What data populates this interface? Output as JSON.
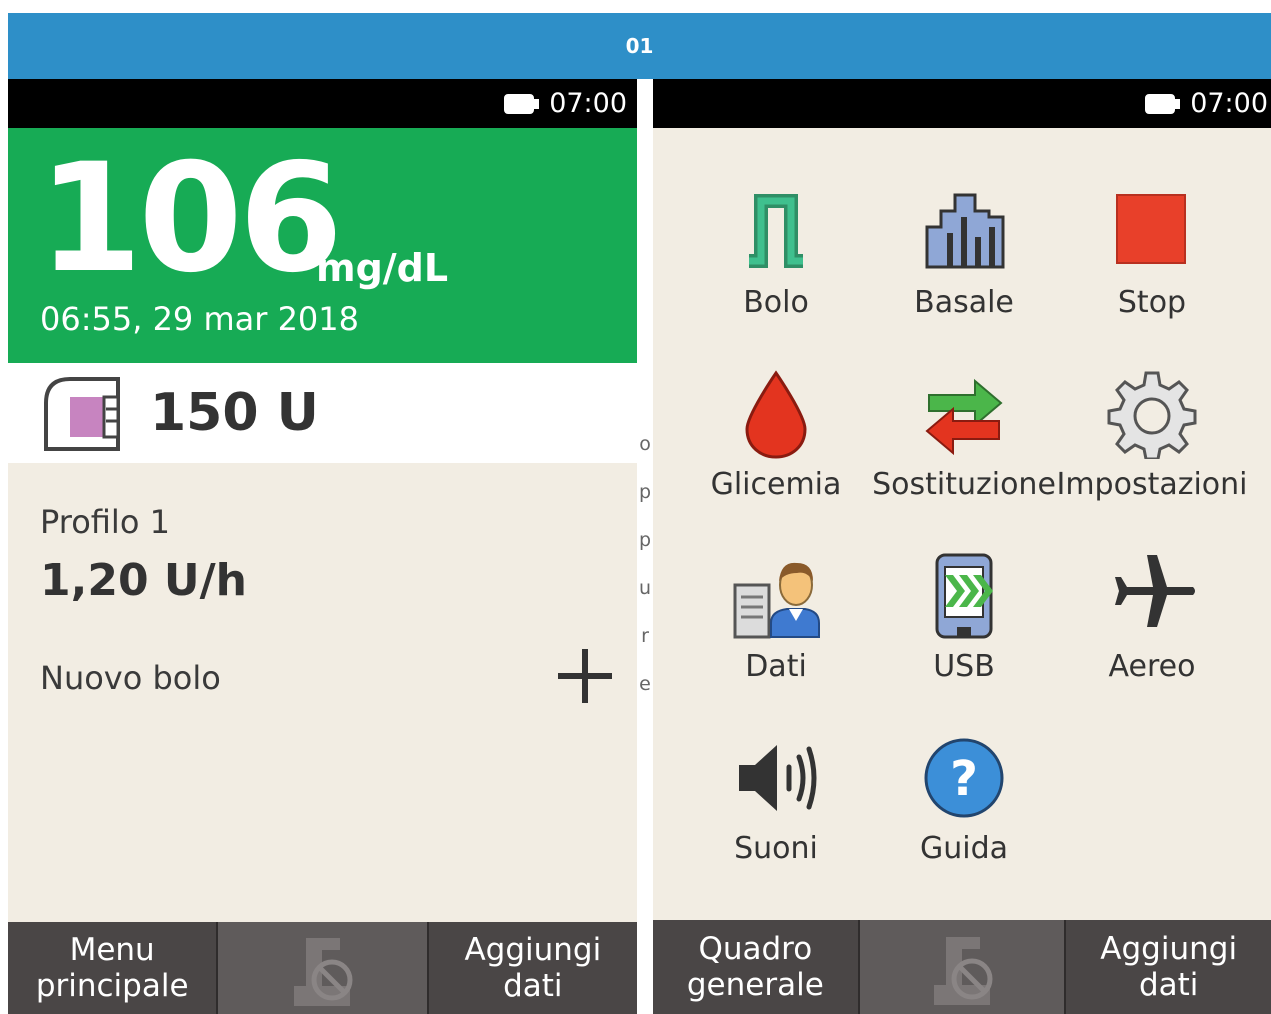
{
  "banner": {
    "label": "01"
  },
  "colors": {
    "banner": "#2e8fc8",
    "glucose_ok": "#17ab55",
    "softkey": "#4a4646",
    "screen_bg": "#f2ede3"
  },
  "home": {
    "status": {
      "time": "07:00"
    },
    "glucose": {
      "value": "106",
      "unit": "mg/dL",
      "timestamp": "06:55, 29 mar 2018"
    },
    "cartridge": {
      "value": "150 U"
    },
    "basal": {
      "profile": "Profilo 1",
      "rate": "1,20 U/h"
    },
    "bolus": {
      "label": "Nuovo bolo"
    },
    "softkeys": {
      "left_line1": "Menu",
      "left_line2": "principale",
      "right_line1": "Aggiungi",
      "right_line2": "dati"
    }
  },
  "vertical_text": [
    "o",
    "p",
    "p",
    "u",
    "r",
    "e"
  ],
  "menu": {
    "status": {
      "time": "07:00"
    },
    "items": [
      {
        "label": "Bolo",
        "icon": "bolus-icon"
      },
      {
        "label": "Basale",
        "icon": "basal-icon"
      },
      {
        "label": "Stop",
        "icon": "stop-icon"
      },
      {
        "label": "Glicemia",
        "icon": "blood-drop-icon"
      },
      {
        "label": "Sostituzione",
        "icon": "exchange-arrows-icon"
      },
      {
        "label": "Impostazioni",
        "icon": "gear-icon"
      },
      {
        "label": "Dati",
        "icon": "data-person-icon"
      },
      {
        "label": "USB",
        "icon": "usb-phone-icon"
      },
      {
        "label": "Aereo",
        "icon": "airplane-icon"
      },
      {
        "label": "Suoni",
        "icon": "speaker-icon"
      },
      {
        "label": "Guida",
        "icon": "help-icon"
      }
    ],
    "softkeys": {
      "left_line1": "Quadro",
      "left_line2": "generale",
      "right_line1": "Aggiungi",
      "right_line2": "dati"
    }
  }
}
